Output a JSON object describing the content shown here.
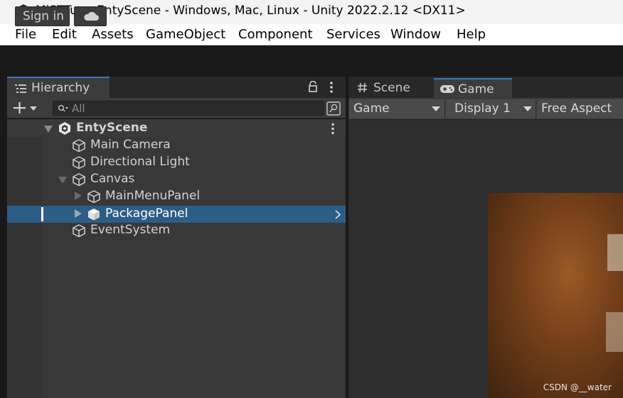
{
  "window": {
    "title": "MiSTTuo - EntyScene - Windows, Mac, Linux - Unity 2022.2.12 <DX11>"
  },
  "menu": {
    "items": [
      "File",
      "Edit",
      "Assets",
      "GameObject",
      "Component",
      "Services",
      "Window",
      "Help"
    ]
  },
  "toolbar": {
    "sign_in_label": "Sign in",
    "cloud_icon": "cloud-icon"
  },
  "hierarchy": {
    "tab_label": "Hierarchy",
    "search_placeholder": "All",
    "scene_name": "EntyScene",
    "items": [
      {
        "label": "Main Camera",
        "depth": 1,
        "expanded": null,
        "selected": false
      },
      {
        "label": "Directional Light",
        "depth": 1,
        "expanded": null,
        "selected": false
      },
      {
        "label": "Canvas",
        "depth": 1,
        "expanded": true,
        "selected": false
      },
      {
        "label": "MainMenuPanel",
        "depth": 2,
        "expanded": false,
        "selected": false
      },
      {
        "label": "PackagePanel",
        "depth": 2,
        "expanded": false,
        "selected": true
      },
      {
        "label": "EventSystem",
        "depth": 1,
        "expanded": null,
        "selected": false
      }
    ]
  },
  "tabs": {
    "scene_label": "Scene",
    "game_label": "Game"
  },
  "game_toolbar": {
    "mode": "Game",
    "display": "Display 1",
    "aspect": "Free Aspect"
  },
  "watermark": "CSDN @__water",
  "colors": {
    "selection": "#2c5d87",
    "tab_accent": "#3a79bb",
    "panel_bg": "#383838",
    "game_bg": "#2e2e2e"
  }
}
